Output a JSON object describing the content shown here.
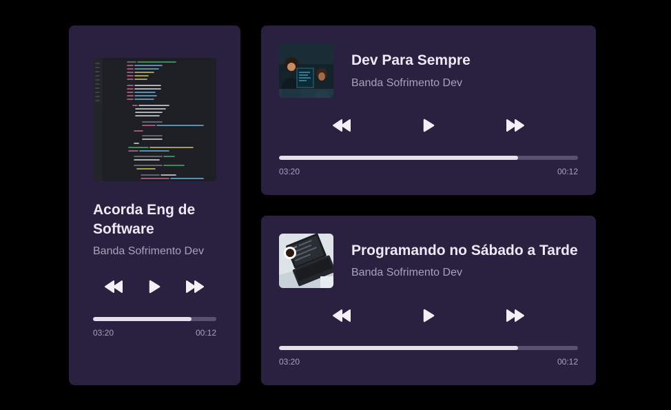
{
  "colors": {
    "background": "#000000",
    "card": "#2a2040",
    "progress_fill": "#e4e0ec",
    "progress_track": "#5a5070",
    "title": "#eee8f5",
    "artist": "#a9a2b8"
  },
  "players": [
    {
      "title": "Acorda Eng de Software",
      "artist": "Banda Sofrimento Dev",
      "elapsed": "03:20",
      "remaining": "00:12",
      "progress_percent": 80,
      "cover": "code-editor-screenshot",
      "controls": {
        "rewind": "rewind-icon",
        "play": "play-icon",
        "forward": "fast-forward-icon"
      }
    },
    {
      "title": "Dev Para Sempre",
      "artist": "Banda Sofrimento Dev",
      "elapsed": "03:20",
      "remaining": "00:12",
      "progress_percent": 80,
      "cover": "developer-at-desk-photo",
      "controls": {
        "rewind": "rewind-icon",
        "play": "play-icon",
        "forward": "fast-forward-icon"
      }
    },
    {
      "title": "Programando no Sábado a Tarde",
      "artist": "Banda Sofrimento Dev",
      "elapsed": "03:20",
      "remaining": "00:12",
      "progress_percent": 80,
      "cover": "laptop-and-coffee-photo",
      "controls": {
        "rewind": "rewind-icon",
        "play": "play-icon",
        "forward": "fast-forward-icon"
      }
    }
  ]
}
